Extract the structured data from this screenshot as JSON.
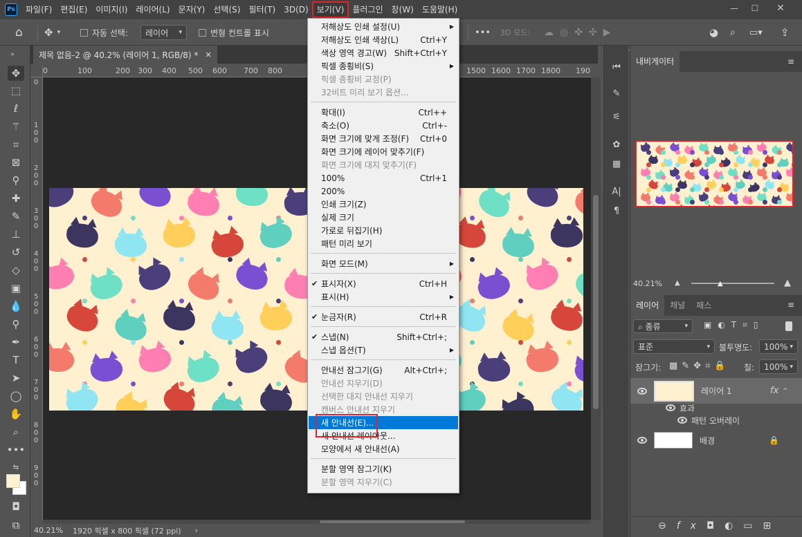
{
  "app": {
    "logo": "Ps"
  },
  "menubar": {
    "items": [
      {
        "label": "파일(F)"
      },
      {
        "label": "편집(E)"
      },
      {
        "label": "이미지(I)"
      },
      {
        "label": "레이어(L)"
      },
      {
        "label": "문자(Y)"
      },
      {
        "label": "선택(S)"
      },
      {
        "label": "필터(T)"
      },
      {
        "label": "3D(D)"
      },
      {
        "label": "보기(V)"
      },
      {
        "label": "플러그인"
      },
      {
        "label": "창(W)"
      },
      {
        "label": "도움말(H)"
      }
    ],
    "active": "보기(V)"
  },
  "options": {
    "auto_select": "자동 선택:",
    "auto_select_target": "레이어",
    "transform_controls": "변형 컨트롤 표시",
    "more": "•••",
    "mode_3d": "3D 모드:"
  },
  "document": {
    "tab_title": "제목 없음-2 @ 40.2% (레이어 1, RGB/8) *",
    "ruler_top_ticks": [
      "0",
      "100",
      "200",
      "300",
      "400",
      "500",
      "600",
      "700",
      "800",
      "1500",
      "1600",
      "1700",
      "1800",
      "190"
    ],
    "ruler_left_ticks": [
      "0",
      "1 0 0",
      "2 0 0",
      "3 0 0",
      "4 0 0",
      "5 0 0",
      "6 0 0",
      "7 0 0",
      "8 0 0",
      "9 0 0"
    ],
    "zoom": "40.21%",
    "size_info": "1920 픽셀 x 800 픽셀 (72 ppi)"
  },
  "view_menu": [
    {
      "label": "저해상도 인쇄 설정(U)",
      "submenu": true
    },
    {
      "label": "저해상도 인쇄 색상(L)",
      "shortcut": "Ctrl+Y"
    },
    {
      "label": "색상 영역 경고(W)",
      "shortcut": "Shift+Ctrl+Y"
    },
    {
      "label": "픽셀 종횡비(S)",
      "submenu": true
    },
    {
      "label": "픽셀 종횡비 교정(P)",
      "disabled": true
    },
    {
      "label": "32비트 미리 보기 옵션...",
      "disabled": true
    },
    {
      "sep": true
    },
    {
      "label": "확대(I)",
      "shortcut": "Ctrl++"
    },
    {
      "label": "축소(O)",
      "shortcut": "Ctrl+-"
    },
    {
      "label": "화면 크기에 맞게 조정(F)",
      "shortcut": "Ctrl+0"
    },
    {
      "label": "화면 크기에 레이어 맞추기(F)"
    },
    {
      "label": "화면 크기에 대지 맞추기(F)",
      "disabled": true
    },
    {
      "label": "100%",
      "shortcut": "Ctrl+1"
    },
    {
      "label": "200%"
    },
    {
      "label": "인쇄 크기(Z)"
    },
    {
      "label": "실제 크기"
    },
    {
      "label": "가로로 뒤집기(H)"
    },
    {
      "label": "패턴 미리 보기"
    },
    {
      "sep": true
    },
    {
      "label": "화면 모드(M)",
      "submenu": true
    },
    {
      "sep": true
    },
    {
      "label": "표시자(X)",
      "shortcut": "Ctrl+H",
      "checked": true
    },
    {
      "label": "표시(H)",
      "submenu": true
    },
    {
      "sep": true
    },
    {
      "label": "눈금자(R)",
      "shortcut": "Ctrl+R",
      "checked": true
    },
    {
      "sep": true
    },
    {
      "label": "스냅(N)",
      "shortcut": "Shift+Ctrl+;",
      "checked": true
    },
    {
      "label": "스냅 옵션(T)",
      "submenu": true
    },
    {
      "sep": true
    },
    {
      "label": "안내선 잠그기(G)",
      "shortcut": "Alt+Ctrl+;"
    },
    {
      "label": "안내선 지우기(D)",
      "disabled": true
    },
    {
      "label": "선택한 대지 안내선 지우기",
      "disabled": true
    },
    {
      "label": "캔버스 안내선 지우기",
      "disabled": true
    },
    {
      "label": "새 안내선(E)...",
      "highlighted": true
    },
    {
      "label": "새 안내선 레이아웃..."
    },
    {
      "label": "모양에서 새 안내선(A)"
    },
    {
      "sep": true
    },
    {
      "label": "분할 영역 잠그기(K)"
    },
    {
      "label": "분할 영역 지우기(C)",
      "disabled": true
    }
  ],
  "navigator": {
    "tab": "내비게이터",
    "zoom": "40.21%"
  },
  "layers": {
    "tabs": [
      "레이어",
      "채널",
      "패스"
    ],
    "filter": "종류",
    "blend_mode": "표준",
    "opacity_label": "불투명도:",
    "opacity": "100%",
    "lock_label": "잠그기:",
    "fill_label": "칠:",
    "fill": "100%",
    "items": [
      {
        "name": "레이어 1",
        "fx": "fx"
      },
      {
        "name": "효과"
      },
      {
        "name": "패턴 오버레이"
      },
      {
        "name": "배경"
      }
    ]
  },
  "colors": {
    "accent_highlight": "#0078d7",
    "annotation_red": "#e0242a"
  }
}
